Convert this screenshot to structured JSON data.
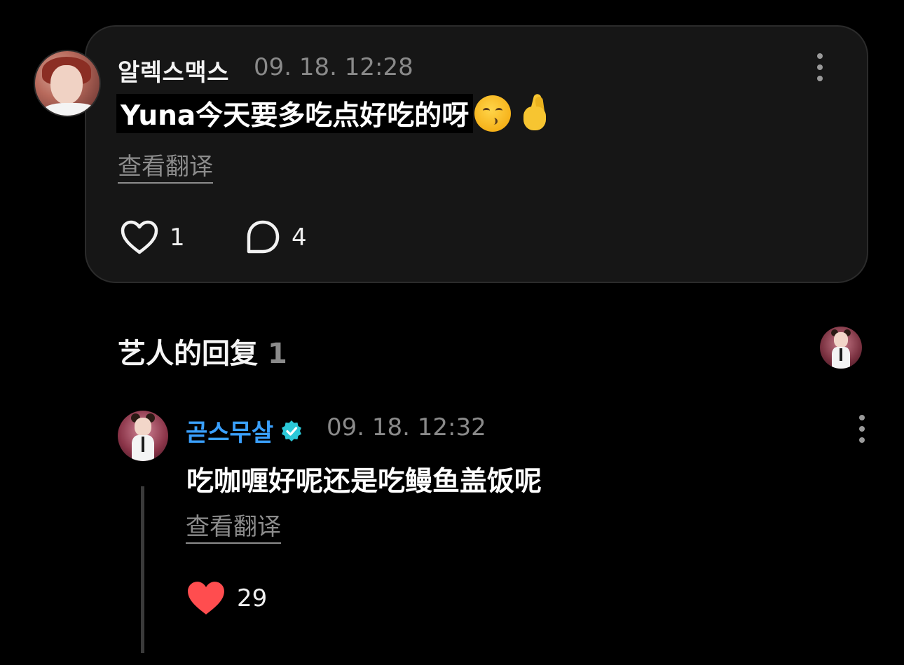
{
  "comment": {
    "username": "알렉스맥스",
    "timestamp": "09. 18. 12:28",
    "text": "Yuna今天要多吃点好吃的呀",
    "emojis": [
      "kissing-face-icon",
      "crossed-fingers-icon"
    ],
    "translate_label": "查看翻译",
    "like_count": "1",
    "reply_count": "4"
  },
  "artist_replies": {
    "title": "艺人的回复",
    "count": "1"
  },
  "reply": {
    "username": "곧스무살",
    "verified": true,
    "timestamp": "09. 18. 12:32",
    "text": "吃咖喱好呢还是吃鳗鱼盖饭呢",
    "translate_label": "查看翻译",
    "like_count": "29",
    "liked": true
  },
  "colors": {
    "background": "#000000",
    "card": "#161616",
    "artist_name": "#3aa0ff",
    "verified_badge": "#2bc8d8",
    "liked_heart": "#ff4d4f",
    "muted_text": "#8a8a8a"
  }
}
